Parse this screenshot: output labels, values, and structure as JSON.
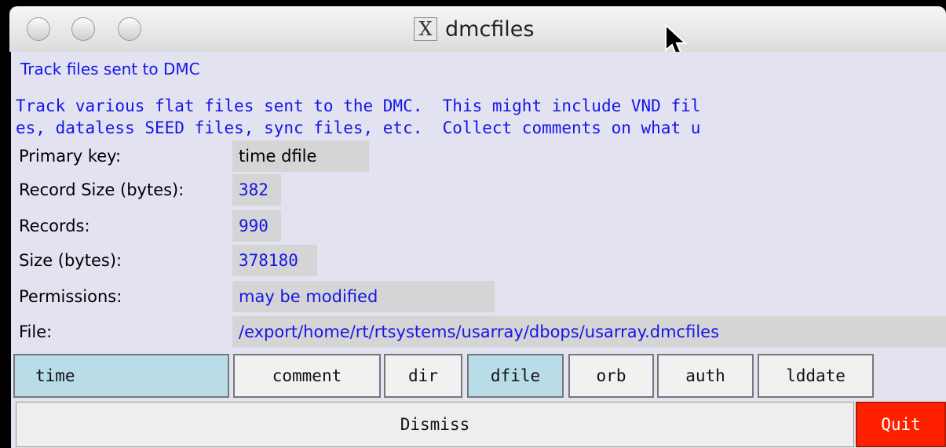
{
  "window": {
    "title": "dmcfiles",
    "x_icon": "X"
  },
  "header": {
    "short_description": "Track files sent to DMC",
    "description_line1": "Track various flat files sent to the DMC.  This might include VND fil",
    "description_line2": "es, dataless SEED files, sync files, etc.  Collect comments on what u"
  },
  "info": {
    "primary_key_label": "Primary key:",
    "primary_key_value": "time dfile",
    "record_size_label": "Record Size (bytes):",
    "record_size_value": "382",
    "records_label": "Records:",
    "records_value": "990",
    "size_label": "Size (bytes):",
    "size_value": "378180",
    "permissions_label": "Permissions:",
    "permissions_value": "may be modified",
    "file_label": "File:",
    "file_value": "/export/home/rt/rtsystems/usarray/dbops/usarray.dmcfiles"
  },
  "fields": [
    "time",
    "comment",
    "dir",
    "dfile",
    "orb",
    "auth",
    "lddate"
  ],
  "actions": {
    "dismiss": "Dismiss",
    "quit": "Quit"
  },
  "colors": {
    "background": "#e2e2f1",
    "text_blue": "#1515e8",
    "key_field": "#b8dde8",
    "quit": "#ff2000"
  }
}
